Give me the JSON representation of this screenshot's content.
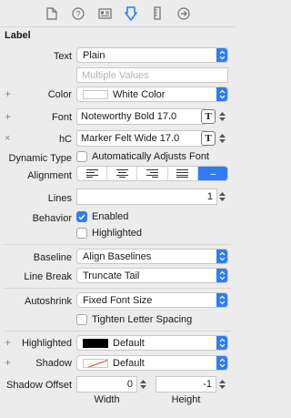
{
  "toolbar": {
    "icons": [
      "file-inspector-icon",
      "quick-help-icon",
      "identity-inspector-icon",
      "attributes-inspector-icon",
      "size-inspector-icon",
      "connections-inspector-icon"
    ]
  },
  "section": {
    "title": "Label"
  },
  "text": {
    "label": "Text",
    "value": "Plain",
    "placeholder": "Multiple Values"
  },
  "color": {
    "label": "Color",
    "value": "White Color"
  },
  "font": {
    "label": "Font",
    "value": "Noteworthy Bold 17.0",
    "button": "T"
  },
  "font_variation": {
    "label": "hC",
    "value": "Marker Felt Wide 17.0",
    "button": "T"
  },
  "dynamic_type": {
    "label": "Dynamic Type",
    "checkbox": "Automatically Adjusts Font"
  },
  "alignment": {
    "label": "Alignment",
    "selected": "natural",
    "natural_glyph": "---"
  },
  "lines": {
    "label": "Lines",
    "value": "1"
  },
  "behavior": {
    "label": "Behavior",
    "enabled": "Enabled",
    "highlighted": "Highlighted"
  },
  "baseline": {
    "label": "Baseline",
    "value": "Align Baselines"
  },
  "line_break": {
    "label": "Line Break",
    "value": "Truncate Tail"
  },
  "autoshrink": {
    "label": "Autoshrink",
    "value": "Fixed Font Size",
    "tighten": "Tighten Letter Spacing"
  },
  "highlighted_color": {
    "label": "Highlighted",
    "value": "Default"
  },
  "shadow": {
    "label": "Shadow",
    "value": "Default"
  },
  "shadow_offset": {
    "label": "Shadow Offset",
    "width": "0",
    "height": "-1",
    "width_label": "Width",
    "height_label": "Height"
  },
  "colors": {
    "accent": "#2f7cf6",
    "background": "#ececec"
  }
}
